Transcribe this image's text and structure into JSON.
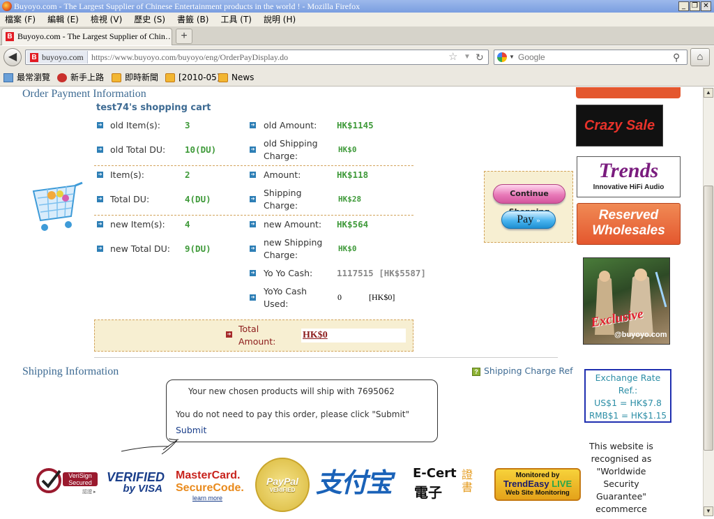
{
  "window": {
    "title": "Buyoyo.com - The Largest Supplier of Chinese Entertainment products in the world ! - Mozilla Firefox"
  },
  "menu": [
    "檔案 (F)",
    "編輯 (E)",
    "檢視 (V)",
    "歷史 (S)",
    "書籤 (B)",
    "工具 (T)",
    "說明 (H)"
  ],
  "tab": {
    "title": "Buyoyo.com - The Largest Supplier of Chin…",
    "new_tab": "+"
  },
  "nav": {
    "site_label": "buyoyo.com",
    "url": "https://www.buyoyo.com/buyoyo/eng/OrderPayDisplay.do",
    "search_placeholder": "Google"
  },
  "bookmarks": [
    "最常瀏覽",
    "新手上路",
    "即時新聞",
    "[2010-05]",
    "News"
  ],
  "order": {
    "section_title": "Order Payment Information",
    "cart_title": "test74's shopping cart",
    "old": {
      "items_label": "old Item(s):",
      "items": "3",
      "du_label": "old Total DU:",
      "du": "10(DU)",
      "amount_label": "old Amount:",
      "amount": "HK$1145",
      "ship_label": "old Shipping Charge:",
      "ship": "HK$0"
    },
    "cur": {
      "items_label": "Item(s):",
      "items": "2",
      "du_label": "Total DU:",
      "du": "4(DU)",
      "amount_label": "Amount:",
      "amount": "HK$118",
      "ship_label": "Shipping Charge:",
      "ship": "HK$28"
    },
    "new": {
      "items_label": "new Item(s):",
      "items": "4",
      "du_label": "new Total DU:",
      "du": "9(DU)",
      "amount_label": "new Amount:",
      "amount": "HK$564",
      "ship_label": "new Shipping Charge:",
      "ship": "HK$0"
    },
    "yoyo_cash_label": "Yo Yo Cash:",
    "yoyo_cash": "1117515 [HK$5587]",
    "yoyo_used_label": "YoYo Cash Used:",
    "yoyo_used": "0",
    "yoyo_used_hk": "[HK$0]",
    "total_label": "Total Amount:",
    "total": "HK$0",
    "continue_btn": "Continue Shopping",
    "pay_btn": "Pay"
  },
  "shipping": {
    "section_title": "Shipping Information",
    "charge_ref": "Shipping Charge Ref",
    "notice1": "Your new chosen products will ship with 7695062",
    "notice2": "You do not need to pay this order, please click \"Submit\"",
    "submit": "Submit"
  },
  "sidebar": {
    "crazy_sale": "Crazy Sale",
    "trends": "Trends",
    "trends_sub": "Innovative HiFi Audio",
    "reserved": "Reserved",
    "wholesales": "Wholesales",
    "exclusive": "Exclusive",
    "exclusive_site": "@buyoyo.com",
    "rate_title": "Exchange Rate Ref.:",
    "rate_usd": "US$1 = HK$7.8",
    "rate_rmb": "RMB$1 = HK$1.15",
    "recognised": "This website is recognised as \"Worldwide Security Guarantee\" ecommerce"
  },
  "footer_logos": {
    "verisign_1": "VeriSign",
    "verisign_2": "Secured",
    "verisign_3": "認證 ▸",
    "visa_1": "VERIFIED",
    "visa_2": "by VISA",
    "mc_1": "MasterCard.",
    "mc_2": "SecureCode.",
    "mc_3": "learn more",
    "paypal_1": "PayPal",
    "paypal_2": "VERIFIED",
    "alipay": "支付宝",
    "ecert_1": "E-Cert",
    "ecert_2": "電子",
    "ecert_3": "證書",
    "trendeasy_1": "Monitored by",
    "trendeasy_2": "TrendEasy",
    "trendeasy_3": "LIVE",
    "trendeasy_4": "Web Site Monitoring"
  },
  "colors": {
    "accent_blue": "#3e6b93",
    "value_green": "#3f9a3a",
    "orange": "#e4572e",
    "beige": "#f7efd2"
  }
}
